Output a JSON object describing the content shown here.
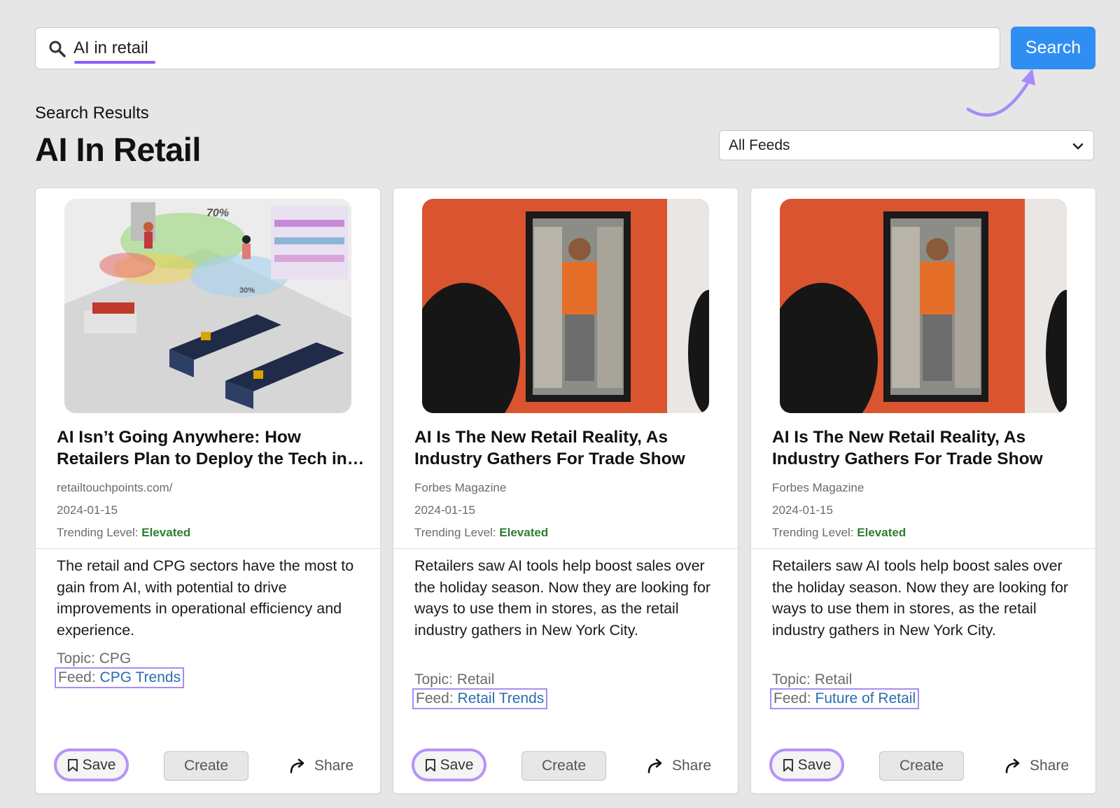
{
  "search": {
    "query": "AI in retail",
    "button_label": "Search"
  },
  "results": {
    "label": "Search Results",
    "title": "AI In Retail"
  },
  "feed_filter": {
    "selected": "All Feeds"
  },
  "colors": {
    "accent": "#2f8ef2",
    "annotation": "#a78bfa",
    "trend_elevated": "#2e7d32",
    "link": "#2b6cb0"
  },
  "cards": [
    {
      "title": "AI Isn’t Going Anywhere: How Retailers Plan to Deploy the Tech in…",
      "source": "retailtouchpoints.com/",
      "date": "2024-01-15",
      "trend_label": "Trending Level: ",
      "trend_value": "Elevated",
      "description": "The retail and CPG sectors have the most to gain from AI, with potential to drive improvements in operational efficiency and experience.",
      "topic": "Topic: CPG",
      "feed_label": "Feed: ",
      "feed_name": "CPG Trends",
      "image_labels": [
        "70%",
        "30%"
      ],
      "save_label": "Save",
      "create_label": "Create",
      "share_label": "Share"
    },
    {
      "title": "AI Is The New Retail Reality, As Industry Gathers For Trade Show",
      "source": "Forbes Magazine",
      "date": "2024-01-15",
      "trend_label": "Trending Level: ",
      "trend_value": "Elevated",
      "description": "Retailers saw AI tools help boost sales over the holiday season. Now they are looking for ways to use them in stores, as the retail industry gathers in New York City.",
      "topic": "Topic: Retail",
      "feed_label": "Feed: ",
      "feed_name": "Retail Trends",
      "save_label": "Save",
      "create_label": "Create",
      "share_label": "Share"
    },
    {
      "title": "AI Is The New Retail Reality, As Industry Gathers For Trade Show",
      "source": "Forbes Magazine",
      "date": "2024-01-15",
      "trend_label": "Trending Level: ",
      "trend_value": "Elevated",
      "description": "Retailers saw AI tools help boost sales over the holiday season. Now they are looking for ways to use them in stores, as the retail industry gathers in New York City.",
      "topic": "Topic: Retail",
      "feed_label": "Feed: ",
      "feed_name": "Future of Retail",
      "save_label": "Save",
      "create_label": "Create",
      "share_label": "Share"
    }
  ]
}
